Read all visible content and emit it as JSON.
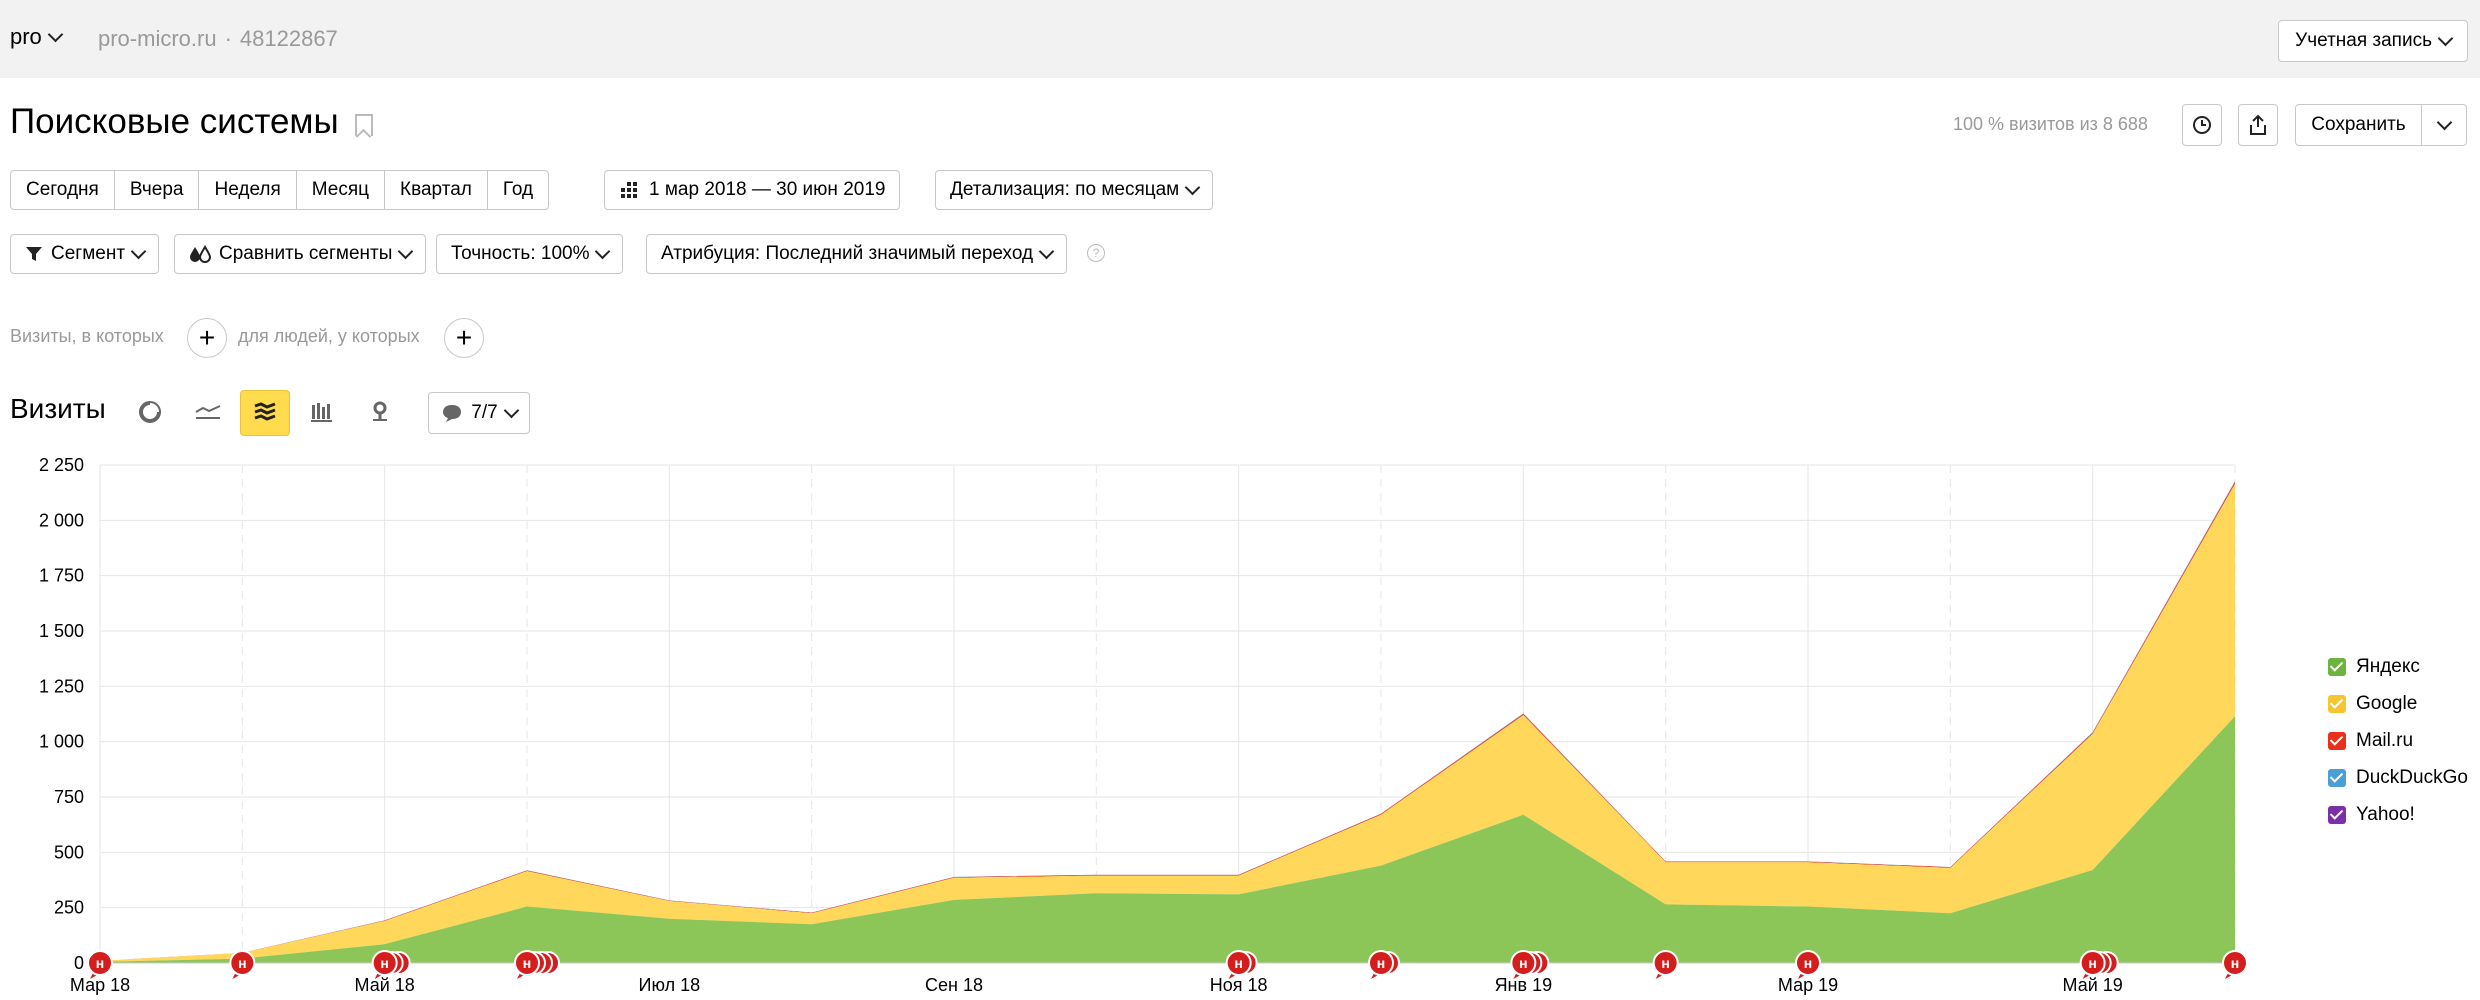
{
  "topbar": {
    "project": "pro",
    "site": "pro-micro.ru",
    "counter_id": "48122867",
    "account_label": "Учетная запись"
  },
  "page": {
    "title": "Поисковые системы",
    "visits_summary": "100 % визитов из 8 688",
    "save_label": "Сохранить"
  },
  "period_buttons": [
    "Сегодня",
    "Вчера",
    "Неделя",
    "Месяц",
    "Квартал",
    "Год"
  ],
  "date_range": "1 мар 2018 — 30 июн 2019",
  "detail_label": "Детализация: по месяцам",
  "filters": {
    "segment": "Сегмент",
    "compare": "Сравнить сегменты",
    "accuracy": "Точность: 100%",
    "attribution": "Атрибуция: Последний значимый переход",
    "help": "?"
  },
  "conditions": {
    "visits_where": "Визиты, в которых",
    "people_where": "для людей, у которых"
  },
  "section": {
    "title": "Визиты",
    "notes_count": "7/7"
  },
  "icons": {
    "pie": "pie-chart-icon",
    "line": "line-chart-icon",
    "area": "stacked-area-icon",
    "bar": "bar-chart-icon",
    "map": "map-pin-icon",
    "note": "speech-bubble-icon",
    "history": "clock-icon",
    "export": "export-icon"
  },
  "colors": {
    "yandex": "#8cc558",
    "google": "#ffd75a",
    "mailru": "#e8301a",
    "duckduckgo": "#4a9fd6",
    "yahoo": "#7b2fa8",
    "marker": "#d41e1e",
    "active_tool": "#ffdb4d"
  },
  "legend": [
    {
      "name": "Яндекс",
      "color": "#6cb33f"
    },
    {
      "name": "Google",
      "color": "#f7c62f"
    },
    {
      "name": "Mail.ru",
      "color": "#e8301a"
    },
    {
      "name": "DuckDuckGo",
      "color": "#4a9fd6"
    },
    {
      "name": "Yahoo!",
      "color": "#7b2fa8"
    }
  ],
  "chart_data": {
    "type": "area",
    "stacked": true,
    "x": [
      "2018-03",
      "2018-04",
      "2018-05",
      "2018-06",
      "2018-07",
      "2018-08",
      "2018-09",
      "2018-10",
      "2018-11",
      "2018-12",
      "2019-01",
      "2019-02",
      "2019-03",
      "2019-04",
      "2019-05",
      "2019-06"
    ],
    "x_tick_labels": [
      {
        "index": 0,
        "label": "Мар 18"
      },
      {
        "index": 2,
        "label": "Май 18"
      },
      {
        "index": 4,
        "label": "Июл 18"
      },
      {
        "index": 6,
        "label": "Сен 18"
      },
      {
        "index": 8,
        "label": "Ноя 18"
      },
      {
        "index": 10,
        "label": "Янв 19"
      },
      {
        "index": 12,
        "label": "Мар 19"
      },
      {
        "index": 14,
        "label": "Май 19"
      }
    ],
    "y_ticks": [
      "0",
      "250",
      "500",
      "750",
      "1 000",
      "1 250",
      "1 500",
      "1 750",
      "2 000",
      "2 250"
    ],
    "ylim": [
      0,
      2250
    ],
    "grid": true,
    "legend_position": "right",
    "series": [
      {
        "name": "Яндекс",
        "values": [
          5,
          20,
          85,
          255,
          200,
          175,
          285,
          315,
          310,
          440,
          670,
          265,
          255,
          225,
          420,
          1115
        ]
      },
      {
        "name": "Google",
        "values": [
          5,
          25,
          105,
          160,
          80,
          50,
          100,
          80,
          85,
          230,
          450,
          190,
          200,
          205,
          615,
          1050
        ]
      },
      {
        "name": "Mail.ru",
        "values": [
          0,
          1,
          2,
          3,
          2,
          2,
          3,
          3,
          3,
          4,
          5,
          3,
          3,
          3,
          5,
          8
        ]
      },
      {
        "name": "DuckDuckGo",
        "values": [
          0,
          0,
          1,
          1,
          1,
          1,
          1,
          1,
          1,
          1,
          2,
          1,
          1,
          1,
          2,
          3
        ]
      },
      {
        "name": "Yahoo!",
        "values": [
          0,
          0,
          0,
          0,
          0,
          0,
          0,
          0,
          0,
          0,
          1,
          0,
          0,
          0,
          1,
          1
        ]
      }
    ],
    "note_markers": [
      {
        "index": 0,
        "count": 1
      },
      {
        "index": 1,
        "count": 1
      },
      {
        "index": 2,
        "count": 3
      },
      {
        "index": 3,
        "count": 4
      },
      {
        "index": 8,
        "count": 2
      },
      {
        "index": 9,
        "count": 2
      },
      {
        "index": 10,
        "count": 3
      },
      {
        "index": 11,
        "count": 1
      },
      {
        "index": 12,
        "count": 1
      },
      {
        "index": 14,
        "count": 3
      },
      {
        "index": 15,
        "count": 1
      }
    ],
    "note_letter": "н"
  }
}
